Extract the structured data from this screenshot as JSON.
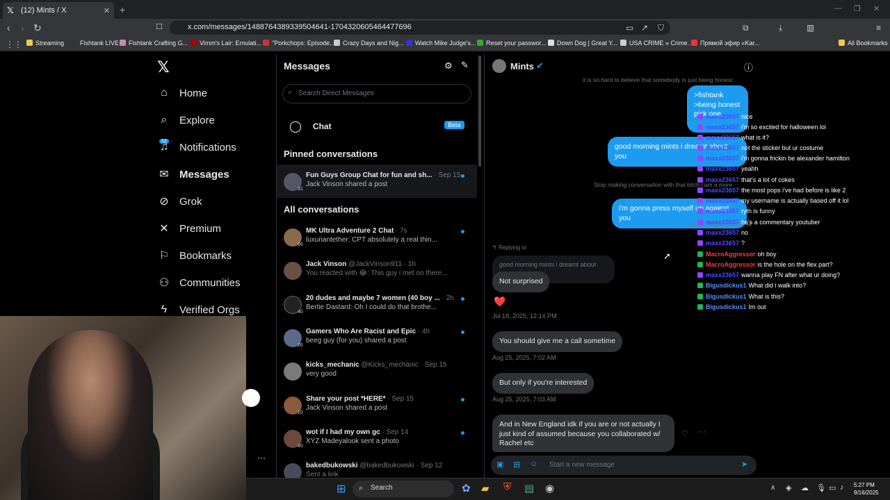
{
  "browser": {
    "tab_title": "(12) Mints / X",
    "url": "x.com/messages/1488764389339504641-1704320605464477696",
    "bookmarks": [
      "Streaming",
      "Fishtank LIVE",
      "Fishtank Crafting G...",
      "Vimm's Lair: Emulati...",
      "\"Porkchops: Episode...",
      "Crazy Days and Nig...",
      "Watch Mike Judge's...",
      "Reset your passwor...",
      "Down Dog | Great Y...",
      "USA CRIME » Crime...",
      "Прямой эфир «Kar...",
      "All Bookmarks"
    ]
  },
  "sidebar": {
    "notif_count": "12",
    "items": [
      "Home",
      "Explore",
      "Notifications",
      "Messages",
      "Grok",
      "Premium",
      "Bookmarks",
      "Communities",
      "Verified Orgs"
    ]
  },
  "messages_panel": {
    "title": "Messages",
    "search_placeholder": "Search Direct Messages",
    "chat_label": "Chat",
    "beta_label": "Beta",
    "pinned_header": "Pinned conversations",
    "all_header": "All conversations",
    "pinned": [
      {
        "name": "Fun Guys Group Chat for fun and sh...",
        "meta": " · Sep 15",
        "snippet": "Jack Vinson shared a post",
        "count": "31"
      }
    ],
    "conversations": [
      {
        "name": "MK Ultra Adventure 2 Chat",
        "meta": " · 7s",
        "snippet": "luxuriantether: CPT absolutely a real thin...",
        "count": "56"
      },
      {
        "name": "Jack Vinson",
        "meta": " @JackVinson911 · 1h",
        "snippet": "You reacted with 😂: This guy i met on there...",
        "count": ""
      },
      {
        "name": "20 dudes and maybe 7 women (40 boy ...",
        "meta": " · 2h",
        "snippet": "Bertie Dastard: Oh I could do that brothe...",
        "count": "40"
      },
      {
        "name": "Gamers Who Are Racist and Epic",
        "meta": " · 4h",
        "snippet": "beeg guy (for you) shared a post",
        "count": "26"
      },
      {
        "name": "kicks_mechanic",
        "meta": " @Kicks_mechanic · Sep 15",
        "snippet": "very good",
        "count": ""
      },
      {
        "name": "Share your post *HERE*",
        "meta": " · Sep 15",
        "snippet": "Jack Vinson shared a post",
        "count": "10"
      },
      {
        "name": "wot if I had my own gc",
        "meta": " · Sep 14",
        "snippet": "XYZ Madeyalook sent a photo",
        "count": "40"
      },
      {
        "name": "bakedbukowski",
        "meta": " @bakedbukowski · Sep 12",
        "snippet": "Sent a link",
        "count": ""
      }
    ]
  },
  "conversation": {
    "name": "Mints",
    "faded_top": "it is so hard to believe that somebody is just being honest",
    "me1": ">fishtank\n>being honest\npick one",
    "me2": "good morning mints i dreamt about you",
    "faded_mid": "Stop making conversation with that bitch i am a more",
    "me3": "i'm gonna press myself up against you",
    "me3_ts": "Jul 18, 2025, 12:07 PM",
    "replying_to": "Replying to",
    "reply_quote": "good morning mints i dreamt about you",
    "them1": "Not surprised",
    "reaction": "❤️",
    "ts1": "Jul 18, 2025, 12:14 PM",
    "them2": "You should give me a call sometime",
    "ts2": "Aug 25, 2025, 7:02 AM",
    "them3": "But only if you're interested",
    "ts3": "Aug 25, 2025, 7:03 AM",
    "them4": "And in New England idk if you are or not actually I just kind of assumed because you collaborated w/ Rachel etc",
    "composer_placeholder": "Start a new message"
  },
  "stream_chat": [
    {
      "user": "maxx23657",
      "msg": "nice",
      "color": "#4a4aff"
    },
    {
      "user": "maxx23657",
      "msg": "i'm so excited for halloween lol",
      "color": "#4a4aff"
    },
    {
      "user": "maxx23657",
      "msg": "what is it?",
      "color": "#4a4aff"
    },
    {
      "user": "maxx23657",
      "msg": "not the sticker but ur costume",
      "color": "#4a4aff"
    },
    {
      "user": "maxx23657",
      "msg": "i'm gonna frickin be alexander hamilton",
      "color": "#4a4aff"
    },
    {
      "user": "maxx23657",
      "msg": "yeahh",
      "color": "#4a4aff"
    },
    {
      "user": "maxx23657",
      "msg": "that's a lot of cokes",
      "color": "#4a4aff"
    },
    {
      "user": "maxx23657",
      "msg": "the most pops i've had before is like 2",
      "color": "#4a4aff"
    },
    {
      "user": "maxx23657",
      "msg": "my username is actually based off it lol",
      "color": "#4a4aff"
    },
    {
      "user": "maxx23657",
      "msg": "ryth is funny",
      "color": "#4a4aff"
    },
    {
      "user": "maxx23657",
      "msg": "he's a commentary youtuber",
      "color": "#4a4aff"
    },
    {
      "user": "maxx23657",
      "msg": "no",
      "color": "#4a4aff"
    },
    {
      "user": "maxx23657",
      "msg": "?",
      "color": "#4a4aff"
    },
    {
      "user": "MacroAggressor",
      "msg": "oh boy",
      "color": "#ff3a3a"
    },
    {
      "user": "MacroAggressor",
      "msg": "is the hole on the flex part?",
      "color": "#ff3a3a"
    },
    {
      "user": "maxx23657",
      "msg": "wanna play FN after what ur doing?",
      "color": "#4a4aff"
    },
    {
      "user": "Bigusdickus1",
      "msg": "What did i walk into?",
      "color": "#5b8cff"
    },
    {
      "user": "Bigusdickus1",
      "msg": "What is this?",
      "color": "#5b8cff"
    },
    {
      "user": "Bigusdickus1",
      "msg": "Im out",
      "color": "#5b8cff"
    }
  ],
  "taskbar": {
    "search_label": "Search",
    "time": "5:27 PM",
    "date": "9/16/2025"
  }
}
